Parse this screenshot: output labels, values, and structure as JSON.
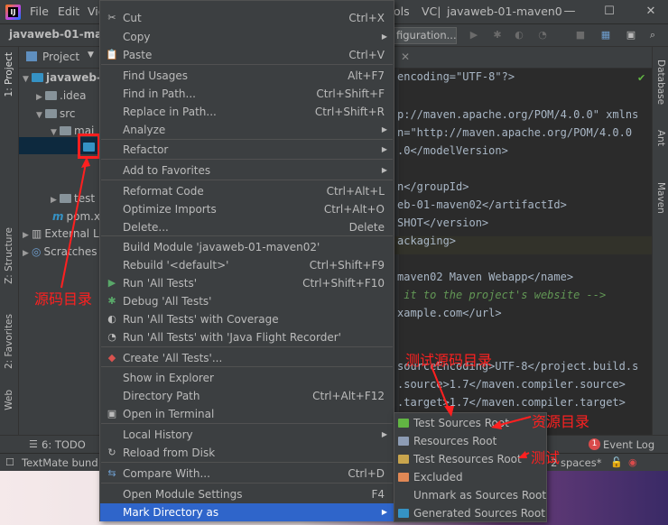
{
  "menubar": {
    "app_icon_letter": "IJ",
    "items": [
      "File",
      "Edit",
      "Vie",
      "ols",
      "VC|"
    ],
    "project_title": "javaweb-01-maven0",
    "minimize": "—",
    "maximize": "☐",
    "close": "✕"
  },
  "toolbar": {
    "breadcrumb": "javaweb-01-mave",
    "run_config": "figuration..."
  },
  "left_stripe": {
    "project": "1: Project",
    "structure": "Z: Structure",
    "favorites": "2: Favorites",
    "web": "Web"
  },
  "right_stripe": {
    "database": "Database",
    "ant": "Ant",
    "maven": "Maven"
  },
  "project_panel": {
    "header": "Project",
    "tree": [
      {
        "label": "javaweb-"
      },
      {
        "label": ".idea"
      },
      {
        "label": "src"
      },
      {
        "label": "mai"
      },
      {
        "label": "test"
      },
      {
        "label": "pom.xr"
      },
      {
        "label": "External L"
      },
      {
        "label": "Scratches"
      }
    ]
  },
  "editor": {
    "lines": [
      "encoding=\"UTF-8\"?>",
      "",
      "p://maven.apache.org/POM/4.0.0\" xmlns",
      "n=\"http://maven.apache.org/POM/4.0.0",
      ".0</modelVersion>",
      "",
      "n</groupId>",
      "eb-01-maven02</artifactId>",
      "SHOT</version>",
      "ackaging>",
      "",
      "maven02 Maven Webapp</name>",
      " it to the project's website -->",
      "xample.com</url>",
      "",
      "",
      "sourceEncoding>UTF-8</project.build.s",
      ".source>1.7</maven.compiler.source>",
      ".target>1.7</maven.compiler.target>"
    ]
  },
  "bottom_tools": {
    "todo": "6: TODO",
    "event_log": "Event Log",
    "event_count": "1"
  },
  "status_bar": {
    "textmate": "TextMate bund",
    "indent": "2 spaces*"
  },
  "context_menu": {
    "items": [
      {
        "label": "Cut",
        "shortcut": "Ctrl+X",
        "icon": "scissors-icon",
        "glyph": "✂"
      },
      {
        "label": "Copy",
        "shortcut": "",
        "sub": true
      },
      {
        "label": "Paste",
        "shortcut": "Ctrl+V",
        "icon": "paste-icon",
        "glyph": "📋"
      },
      {
        "label": "Find Usages",
        "shortcut": "Alt+F7"
      },
      {
        "label": "Find in Path...",
        "shortcut": "Ctrl+Shift+F"
      },
      {
        "label": "Replace in Path...",
        "shortcut": "Ctrl+Shift+R"
      },
      {
        "label": "Analyze",
        "sub": true
      },
      {
        "label": "Refactor",
        "sub": true
      },
      {
        "label": "Add to Favorites",
        "sub": true
      },
      {
        "label": "Reformat Code",
        "shortcut": "Ctrl+Alt+L"
      },
      {
        "label": "Optimize Imports",
        "shortcut": "Ctrl+Alt+O"
      },
      {
        "label": "Delete...",
        "shortcut": "Delete"
      },
      {
        "label": "Build Module 'javaweb-01-maven02'"
      },
      {
        "label": "Rebuild '<default>'",
        "shortcut": "Ctrl+Shift+F9"
      },
      {
        "label": "Run 'All Tests'",
        "shortcut": "Ctrl+Shift+F10",
        "icon": "run-icon",
        "glyph": "▶"
      },
      {
        "label": "Debug 'All Tests'",
        "icon": "debug-icon",
        "glyph": "✱"
      },
      {
        "label": "Run 'All Tests' with Coverage",
        "icon": "coverage-icon",
        "glyph": "◐"
      },
      {
        "label": "Run 'All Tests' with 'Java Flight Recorder'",
        "icon": "flight-recorder-icon",
        "glyph": "◔"
      },
      {
        "label": "Create 'All Tests'...",
        "icon": "create-test-icon",
        "glyph": "◆"
      },
      {
        "label": "Show in Explorer"
      },
      {
        "label": "Directory Path",
        "shortcut": "Ctrl+Alt+F12"
      },
      {
        "label": "Open in Terminal",
        "icon": "terminal-icon",
        "glyph": "▣"
      },
      {
        "label": "Local History",
        "sub": true
      },
      {
        "label": "Reload from Disk",
        "icon": "reload-icon",
        "glyph": "↻"
      },
      {
        "label": "Compare With...",
        "shortcut": "Ctrl+D",
        "icon": "compare-icon",
        "glyph": "⇆"
      },
      {
        "label": "Open Module Settings",
        "shortcut": "F4"
      },
      {
        "label": "Mark Directory as",
        "sub": true
      }
    ]
  },
  "submenu": {
    "items": [
      {
        "label": "Test Sources Root",
        "color": "#62b543"
      },
      {
        "label": "Resources Root",
        "color": "#8d9cb4"
      },
      {
        "label": "Test Resources Root",
        "color": "#c9a54d"
      },
      {
        "label": "Excluded",
        "color": "#e08855"
      },
      {
        "label": "Unmark as Sources Root",
        "color": ""
      },
      {
        "label": "Generated Sources Root",
        "color": "#3592c4"
      }
    ]
  },
  "annotations": {
    "source_dir": "源码目录",
    "test_source_dir": "测试源码目录",
    "resource_dir": "资源目录",
    "test": "测试"
  }
}
